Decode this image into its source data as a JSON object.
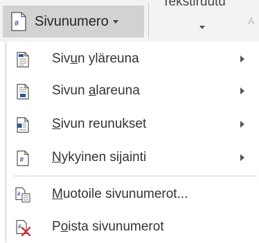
{
  "ribbon": {
    "page_number_button": {
      "label": "Sivunumero",
      "icon": "page-number-icon"
    },
    "textbox_button": {
      "label": "Tekstiruutu"
    },
    "next_button": {
      "label": "A"
    }
  },
  "menu": {
    "items": [
      {
        "label": "Sivun yläreuna",
        "mnemonic": "u",
        "icon": "page-top-icon",
        "has_submenu": true
      },
      {
        "label": "Sivun alareuna",
        "mnemonic": "a",
        "icon": "page-bottom-icon",
        "has_submenu": true
      },
      {
        "label": "Sivun reunukset",
        "mnemonic": "S",
        "icon": "page-margins-icon",
        "has_submenu": true
      },
      {
        "label": "Nykyinen sijainti",
        "mnemonic": "N",
        "icon": "current-position-icon",
        "has_submenu": true
      },
      {
        "label": "Muotoile sivunumerot...",
        "mnemonic": "M",
        "icon": "format-page-numbers-icon",
        "has_submenu": false
      },
      {
        "label": "Poista sivunumerot",
        "mnemonic": "o",
        "icon": "remove-page-numbers-icon",
        "has_submenu": false
      }
    ]
  }
}
